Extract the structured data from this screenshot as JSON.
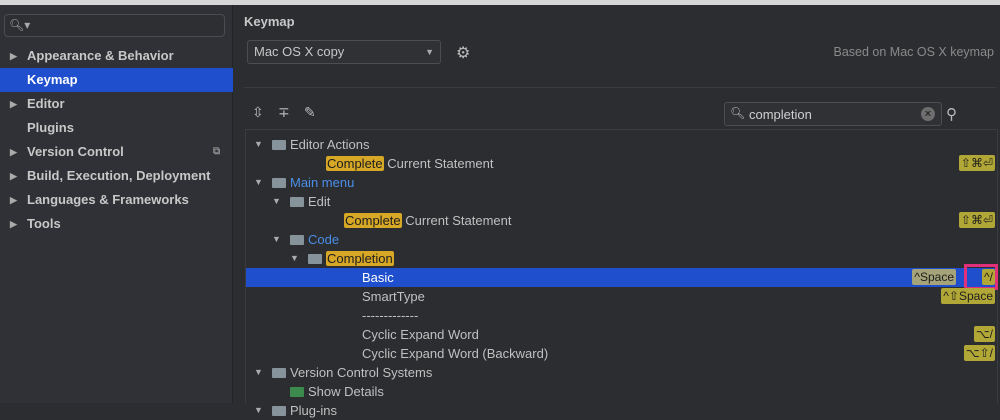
{
  "sidebar": {
    "search_placeholder": "",
    "items": [
      {
        "label": "Appearance & Behavior",
        "arrow": "▶"
      },
      {
        "label": "Keymap",
        "arrow": ""
      },
      {
        "label": "Editor",
        "arrow": "▶"
      },
      {
        "label": "Plugins",
        "arrow": ""
      },
      {
        "label": "Version Control",
        "arrow": "▶"
      },
      {
        "label": "Build, Execution, Deployment",
        "arrow": "▶"
      },
      {
        "label": "Languages & Frameworks",
        "arrow": "▶"
      },
      {
        "label": "Tools",
        "arrow": "▶"
      }
    ]
  },
  "main": {
    "title": "Keymap",
    "keymap_select": "Mac OS X copy",
    "based_on": "Based on Mac OS X keymap",
    "search_value": "completion"
  },
  "tree": [
    {
      "hl": "",
      "text": "Editor Actions",
      "sc": ""
    },
    {
      "hl": "Complete",
      "text": " Current Statement",
      "sc": "⇧⌘⏎"
    },
    {
      "hl": "",
      "text": "Main menu",
      "sc": ""
    },
    {
      "hl": "",
      "text": "Edit",
      "sc": ""
    },
    {
      "hl": "Complete",
      "text": " Current Statement",
      "sc": "⇧⌘⏎"
    },
    {
      "hl": "",
      "text": "Code",
      "sc": ""
    },
    {
      "hl": "Completion",
      "text": "",
      "sc": ""
    },
    {
      "hl": "",
      "text": "Basic",
      "sc": "^/",
      "sc2": "^Space"
    },
    {
      "hl": "",
      "text": "SmartType",
      "sc": "^⇧Space"
    },
    {
      "hl": "",
      "text": "-------------",
      "sc": ""
    },
    {
      "hl": "",
      "text": "Cyclic Expand Word",
      "sc": "⌥/"
    },
    {
      "hl": "",
      "text": "Cyclic Expand Word (Backward)",
      "sc": "⌥⇧/"
    },
    {
      "hl": "",
      "text": "Version Control Systems",
      "sc": ""
    },
    {
      "hl": "",
      "text": "Show Details",
      "sc": ""
    },
    {
      "hl": "",
      "text": "Plug-ins",
      "sc": ""
    }
  ]
}
